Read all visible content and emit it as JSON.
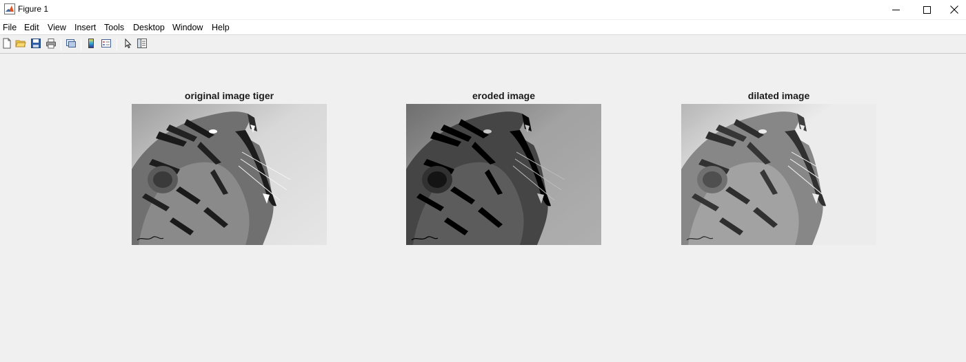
{
  "window": {
    "title": "Figure 1",
    "controls": [
      "minimize-icon",
      "maximize-icon",
      "close-icon"
    ]
  },
  "menubar": {
    "items": [
      "File",
      "Edit",
      "View",
      "Insert",
      "Tools",
      "Desktop",
      "Window",
      "Help"
    ]
  },
  "toolbar": {
    "buttons": [
      {
        "icon": "new-figure-icon"
      },
      {
        "icon": "open-file-icon"
      },
      {
        "icon": "save-icon"
      },
      {
        "icon": "print-icon"
      },
      {
        "icon": "link-plot-icon"
      },
      {
        "icon": "insert-colorbar-icon"
      },
      {
        "icon": "insert-legend-icon"
      },
      {
        "icon": "edit-plot-icon"
      },
      {
        "icon": "property-inspector-icon"
      }
    ]
  },
  "subplots": [
    {
      "title": "original image tiger",
      "image": "tiger-original-image",
      "tone": "original"
    },
    {
      "title": "eroded image",
      "image": "tiger-eroded-image",
      "tone": "eroded"
    },
    {
      "title": "dilated image",
      "image": "tiger-dilated-image",
      "tone": "dilated"
    }
  ],
  "colors": {
    "background": "#f0f0f0",
    "titlebar": "#ffffff",
    "matlab_icon": "#e0531d"
  }
}
